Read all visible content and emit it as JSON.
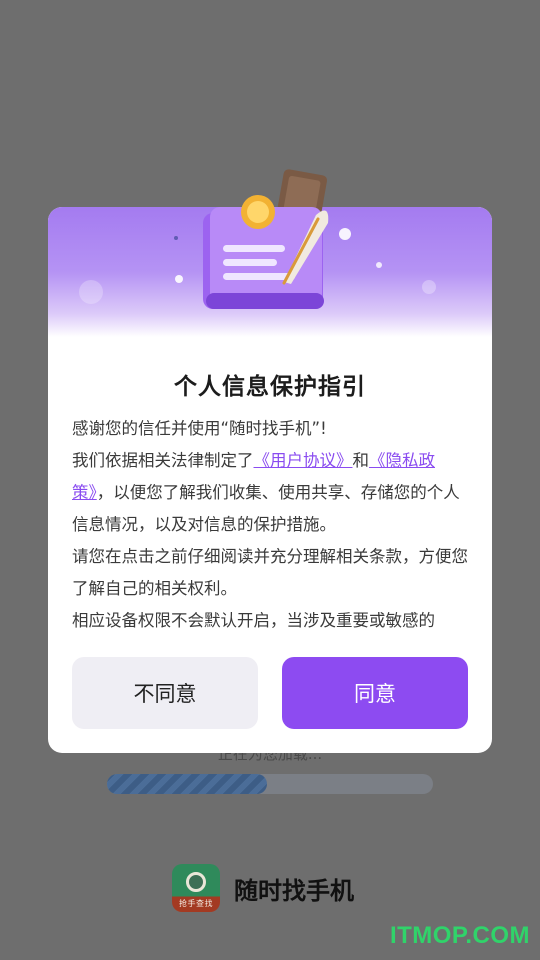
{
  "background": {
    "loading_text": "正在为您加载...",
    "progress_fraction": 0.49,
    "app_name": "随时找手机",
    "logo_caption": "抢手查找",
    "watermark": "ITMOP.COM"
  },
  "dialog": {
    "title": "个人信息保护指引",
    "para1": "感谢您的信任并使用“随时找手机”!",
    "para2_prefix": "我们依据相关法律制定了",
    "user_agreement_link": "《用户协议》",
    "and_text": "和",
    "privacy_policy_link": "《隐私政策》",
    "para2_suffix": "，以便您了解我们收集、使用共享、存储您的个人信息情况，以及对信息的保护措施。",
    "para3": "请您在点击之前仔细阅读并充分理解相关条款，方便您了解自己的相关权利。",
    "para4": "相应设备权限不会默认开启，当涉及重要或敏感的",
    "disagree_label": "不同意",
    "agree_label": "同意"
  },
  "colors": {
    "accent": "#8d4bf1",
    "link": "#8a4cf0",
    "overlay": "#6e6e6e"
  }
}
